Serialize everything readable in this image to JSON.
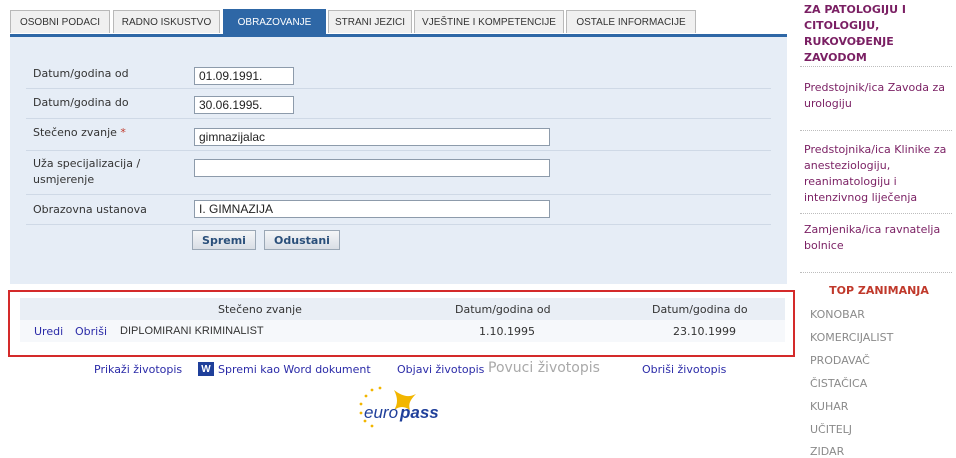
{
  "tabs": [
    {
      "label": "OSOBNI PODACI",
      "active": false
    },
    {
      "label": "RADNO ISKUSTVO",
      "active": false
    },
    {
      "label": "OBRAZOVANJE",
      "active": true
    },
    {
      "label": "STRANI JEZICI",
      "active": false
    },
    {
      "label": "VJEŠTINE I KOMPETENCIJE",
      "active": false
    },
    {
      "label": "OSTALE INFORMACIJE",
      "active": false
    }
  ],
  "form": {
    "date_from_label": "Datum/godina od",
    "date_from_value": "01.09.1991.",
    "date_to_label": "Datum/godina do",
    "date_to_value": "30.06.1995.",
    "title_label": "Stečeno zvanje",
    "title_required": "*",
    "title_value": "gimnazijalac",
    "specialization_label_1": "Uža specijalizacija /",
    "specialization_label_2": "usmjerenje",
    "specialization_value": "",
    "institution_label": "Obrazovna ustanova",
    "institution_value": "I. GIMNAZIJA",
    "save_label": "Spremi",
    "cancel_label": "Odustani"
  },
  "results": {
    "headers": [
      "Stečeno zvanje",
      "Datum/godina od",
      "Datum/godina do"
    ],
    "rows": [
      {
        "edit": "Uredi",
        "delete": "Obriši",
        "title": "DIPLOMIRANI KRIMINALIST",
        "from": "1.10.1995",
        "to": "23.10.1999"
      }
    ]
  },
  "bottom_links": {
    "show": "Prikaži životopis",
    "word_icon": "W",
    "save_word": "Spremi kao Word dokument",
    "publish": "Objavi životopis",
    "withdraw": "Povuci životopis",
    "delete": "Obriši životopis"
  },
  "logo": {
    "text_euro": "euro",
    "text_pass": "pass"
  },
  "sidebar": {
    "top_cut": "ZA PATOLOGIJU I CITOLOGIJU, RUKOVOĐENJE ZAVODOM",
    "links": [
      "Predstojnik/ica Zavoda za urologiju",
      "Predstojnika/ica Klinike za anesteziologiju, reanimatologiju i intenzivnog liječenja",
      "Zamjenika/ica ravnatelja bolnice"
    ],
    "top_title": "TOP ZANIMANJA",
    "jobs": [
      "KONOBAR",
      "KOMERCIJALIST",
      "PRODAVAČ",
      "ČISTAČICA",
      "KUHAR",
      "UČITELJ",
      "ZIDAR"
    ]
  },
  "colors": {
    "accent": "#2e67a6",
    "panel": "#e6edf6",
    "highlight": "#d42a2a",
    "link": "#2b2ba8",
    "sidebar_link": "#7a1f63"
  }
}
